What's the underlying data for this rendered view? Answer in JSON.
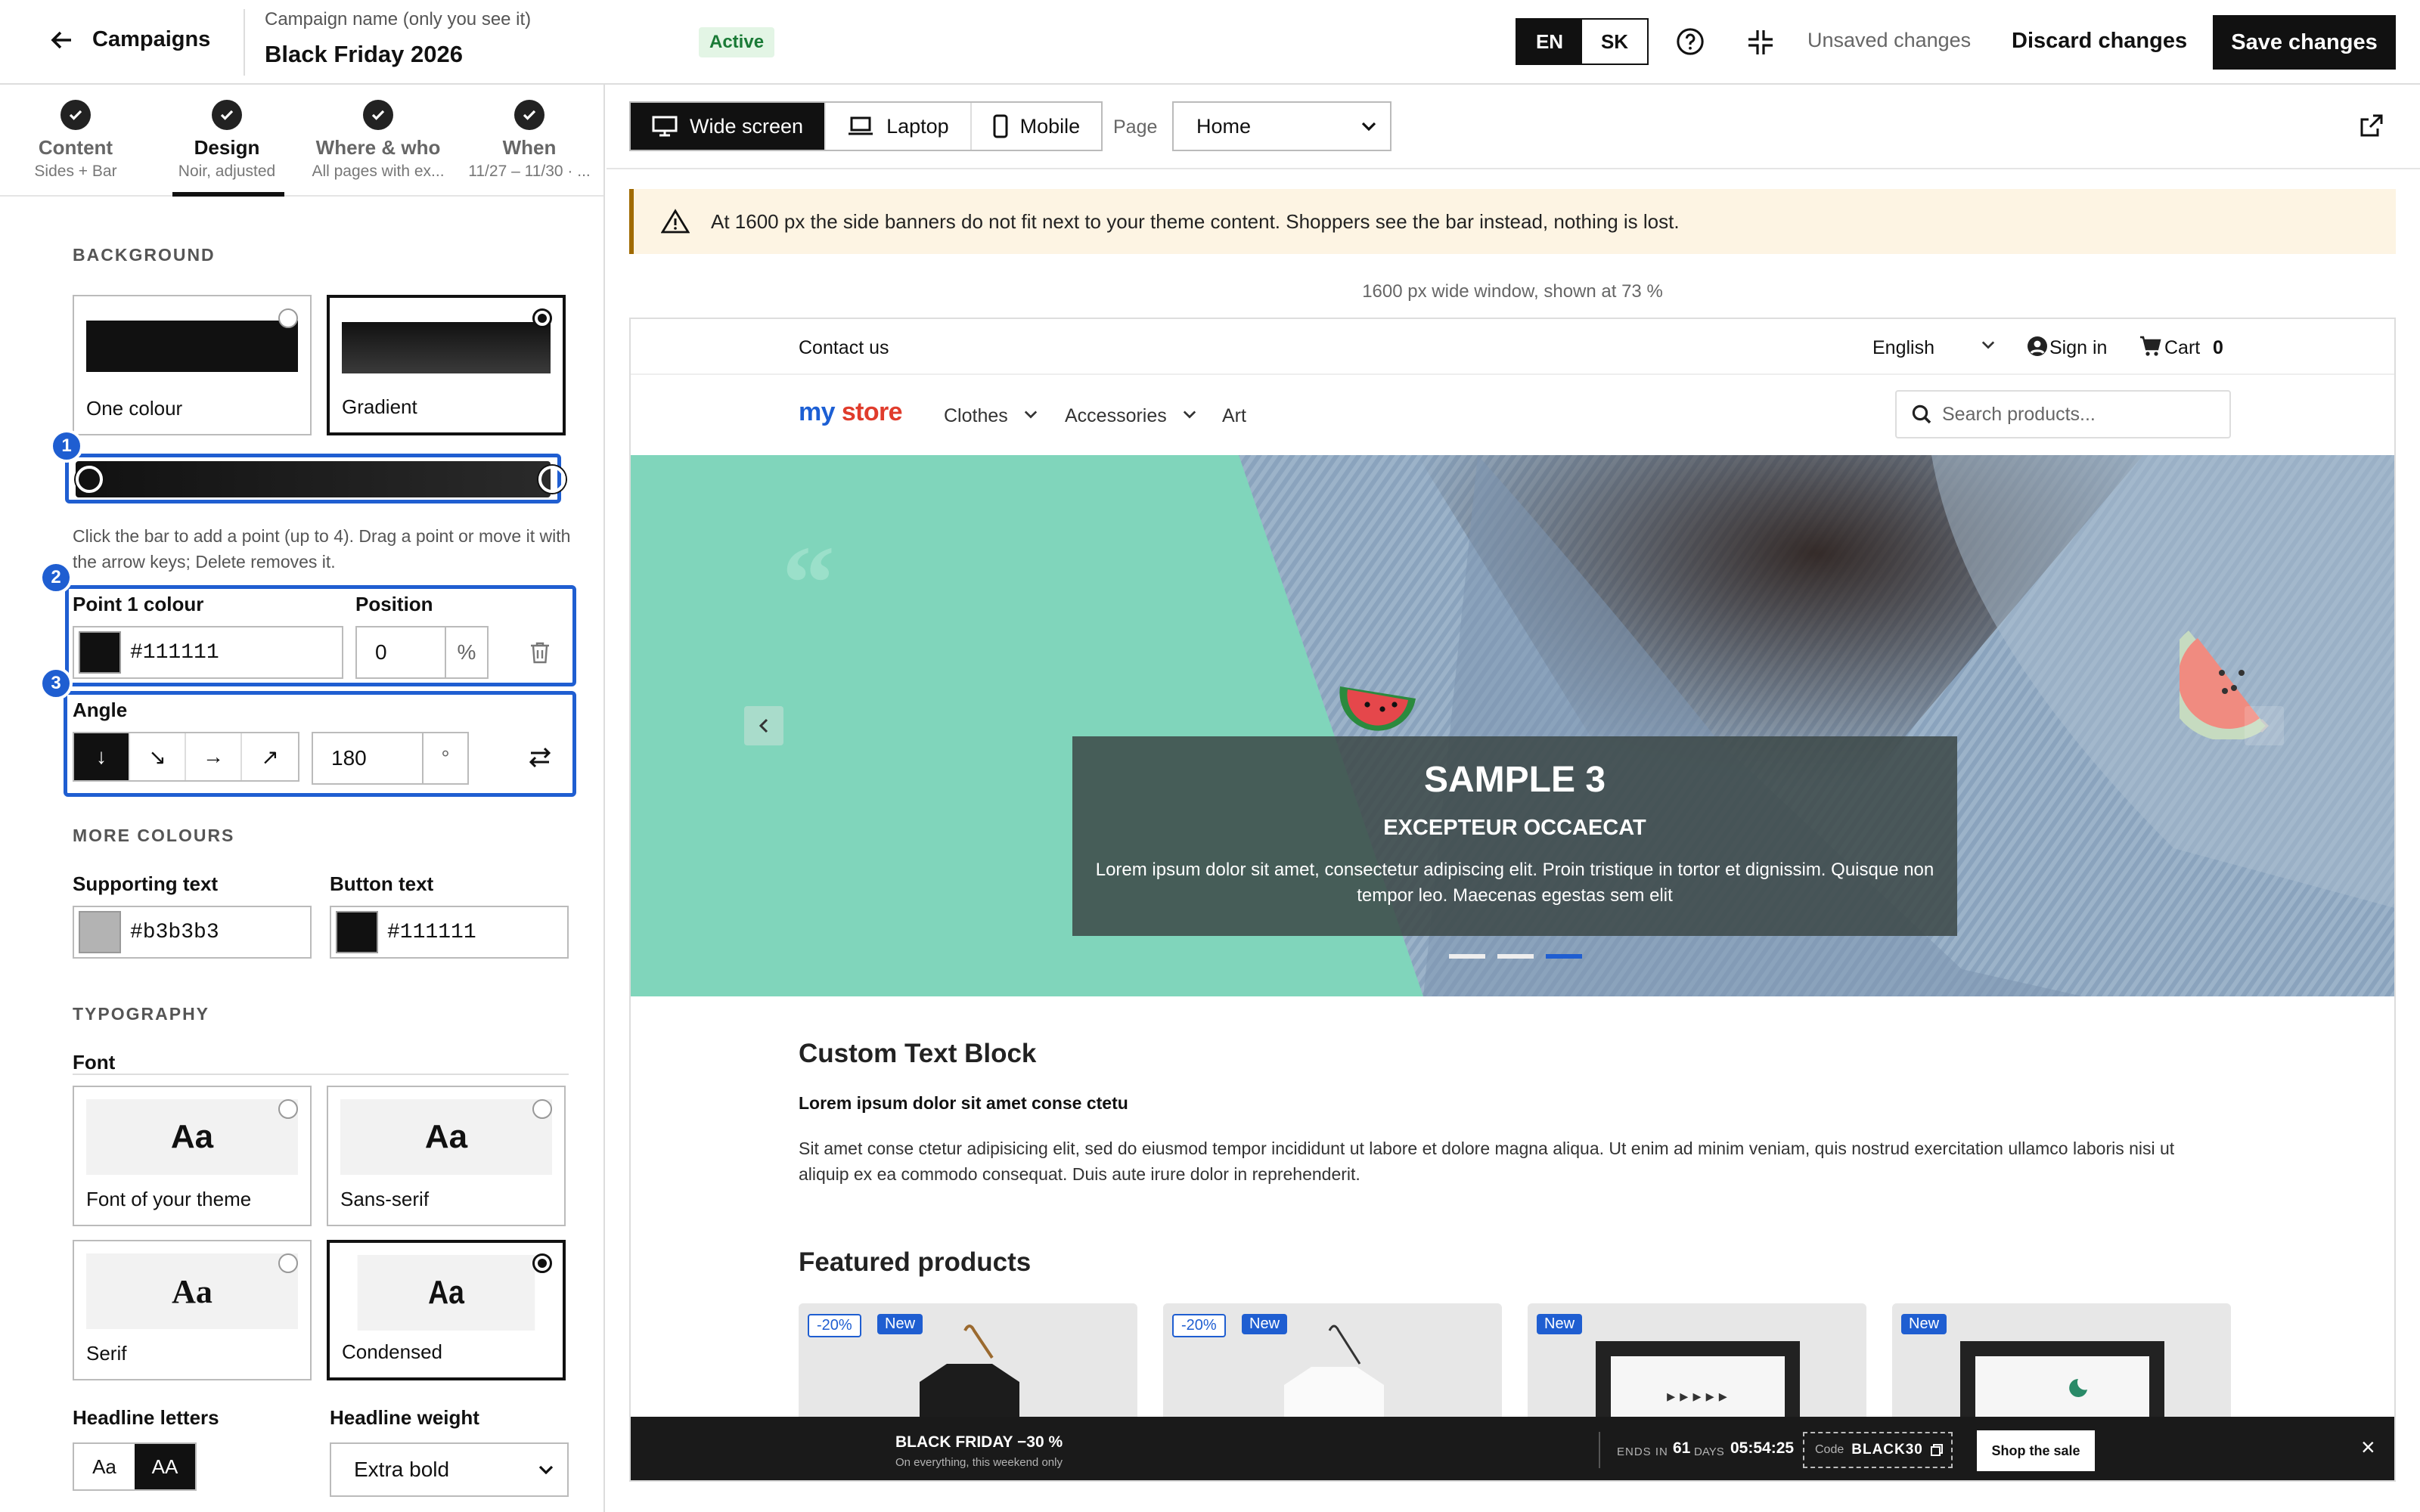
{
  "topbar": {
    "back_label": "Campaigns",
    "campaign_name_label": "Campaign name (only you see it)",
    "campaign_name": "Black Friday 2026",
    "status": "Active",
    "languages": [
      "EN",
      "SK"
    ],
    "active_language": "EN",
    "unsaved_text": "Unsaved changes",
    "discard_label": "Discard changes",
    "save_label": "Save changes"
  },
  "steps": [
    {
      "title": "Content",
      "sub": "Sides + Bar"
    },
    {
      "title": "Design",
      "sub": "Noir, adjusted"
    },
    {
      "title": "Where & who",
      "sub": "All pages with ex..."
    },
    {
      "title": "When",
      "sub": "11/27 – 11/30 · ..."
    }
  ],
  "background": {
    "heading": "BACKGROUND",
    "options": [
      {
        "label": "One colour"
      },
      {
        "label": "Gradient"
      }
    ],
    "selected": "Gradient",
    "help": "Click the bar to add a point (up to 4). Drag a point or move it with the arrow keys; Delete removes it.",
    "point_colour_label": "Point 1 colour",
    "point_colour": "#111111",
    "position_label": "Position",
    "position_value": "0",
    "position_unit": "%",
    "angle_label": "Angle",
    "angle_directions": [
      "↓",
      "↘",
      "→",
      "↗"
    ],
    "angle_value": "180",
    "angle_unit": "°",
    "markers": [
      "1",
      "2",
      "3"
    ]
  },
  "more_colours": {
    "heading": "MORE COLOURS",
    "supporting_label": "Supporting text",
    "supporting_value": "#b3b3b3",
    "button_label": "Button text",
    "button_value": "#111111"
  },
  "typography": {
    "heading": "TYPOGRAPHY",
    "font_label": "Font",
    "fonts": [
      {
        "preview": "Aa",
        "label": "Font of your theme"
      },
      {
        "preview": "Aa",
        "label": "Sans-serif"
      },
      {
        "preview": "Aa",
        "label": "Serif"
      },
      {
        "preview": "Aa",
        "label": "Condensed"
      }
    ],
    "selected_font": "Condensed",
    "headline_letters_label": "Headline letters",
    "headline_letters_options": [
      "Aa",
      "AA"
    ],
    "headline_weight_label": "Headline weight",
    "headline_weight": "Extra bold"
  },
  "preview_toolbar": {
    "devices": [
      "Wide screen",
      "Laptop",
      "Mobile"
    ],
    "active_device": "Wide screen",
    "page_label": "Page",
    "page_value": "Home"
  },
  "warning": "At 1600 px the side banners do not fit next to your theme content. Shoppers see the bar instead, nothing is lost.",
  "window_info": "1600 px wide window, shown at 73 %",
  "store": {
    "contact": "Contact us",
    "language": "English",
    "sign_in": "Sign in",
    "cart_label": "Cart",
    "cart_count": "0",
    "logo_my": "my",
    "logo_store": "store",
    "nav": [
      "Clothes",
      "Accessories",
      "Art"
    ],
    "search_placeholder": "Search products...",
    "slide_title": "SAMPLE 3",
    "slide_subtitle": "EXCEPTEUR OCCAECAT",
    "slide_text": "Lorem ipsum dolor sit amet, consectetur adipiscing elit. Proin tristique in tortor et dignissim. Quisque non tempor leo. Maecenas egestas sem elit",
    "custom_block_title": "Custom Text Block",
    "custom_block_bold": "Lorem ipsum dolor sit amet conse ctetu",
    "custom_block_text": "Sit amet conse ctetur adipisicing elit, sed do eiusmod tempor incididunt ut labore et dolore magna aliqua. Ut enim ad minim veniam, quis nostrud exercitation ullamco laboris nisi ut aliquip ex ea commodo consequat. Duis aute irure dolor in reprehenderit.",
    "featured_title": "Featured products",
    "product_tags": [
      [
        "-20%",
        "New"
      ],
      [
        "-20%",
        "New"
      ],
      [
        "New"
      ],
      [
        "New"
      ]
    ]
  },
  "sale_bar": {
    "title": "BLACK FRIDAY −30 %",
    "subtitle": "On everything, this weekend only",
    "ends_in": "ENDS IN",
    "days": "61",
    "days_label": "DAYS",
    "time": "05:54:25",
    "code_label": "Code",
    "code": "BLACK30",
    "cta": "Shop the sale",
    "close": "×"
  }
}
